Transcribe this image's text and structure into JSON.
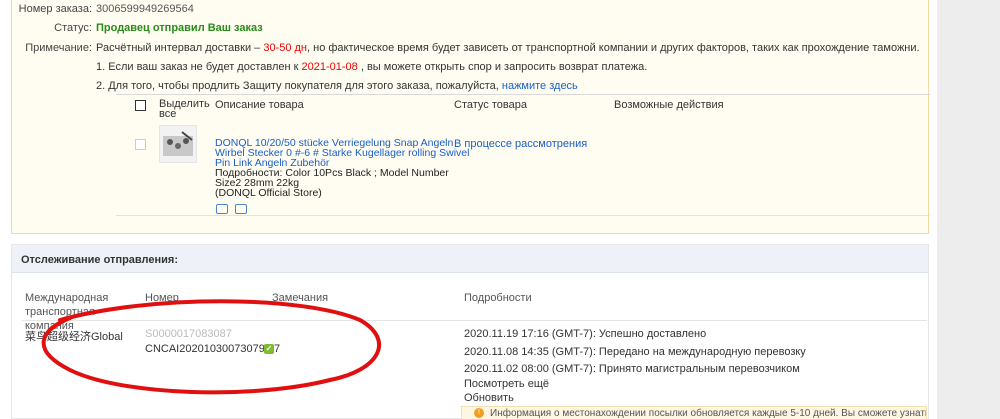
{
  "order": {
    "order_no_label": "Номер заказа:",
    "order_no": "3006599949269564",
    "status_label": "Статус:",
    "status": "Продавец отправил Ваш заказ",
    "note_label": "Примечание:",
    "note_prefix": "Расчётный интервал доставки –",
    "note_interval": "30-50 дн",
    "note_suffix": ", но фактическое время будет зависеть от транспортной компании и других факторов, таких как прохождение таможни.",
    "rule1_prefix": "1. Если ваш заказ не будет доставлен к",
    "rule1_date": "2021-01-08",
    "rule1_suffix": ", вы можете открыть спор и запросить возврат платежа.",
    "rule2_text": "2. Для того, чтобы продлить Защиту покупателя для этого заказа, пожалуйста,",
    "rule2_link": "нажмите здесь"
  },
  "items_table": {
    "col_select": "Выделить все",
    "col_description": "Описание товара",
    "col_status": "Статус товара",
    "col_actions": "Возможные действия",
    "rows": [
      {
        "title": "DONQL 10/20/50 stücke Verriegelung Snap Angeln Wirbel Stecker 0 #-6 # Starke Kugellager rolling Swivel Pin Link Angeln Zubehör",
        "details_1": "Подробности: Color 10Pcs Black ; Model Number Size2 28mm 22kg",
        "details_2": "(DONQL Official Store)",
        "status": "В процессе рассмотрения",
        "icons": [
          "truck-icon",
          "receipt-icon"
        ]
      }
    ]
  },
  "tracking": {
    "title": "Отслеживание отправления:",
    "col_carrier": "Международная транспортная компания",
    "col_number": "Номер",
    "col_remarks": "Замечания",
    "col_details": "Подробности",
    "carrier": "菜鸟超级经济Global",
    "old_number": "S0000017083087",
    "tracking_number": "CNCAI202010300730791 7",
    "events": [
      "2020.11.19 17:16 (GMT-7): Успешно доставлено",
      "2020.11.08 14:35 (GMT-7): Передано на международную перевозку",
      "2020.11.02 08:00 (GMT-7): Принято магистральным перевозчиком"
    ],
    "see_more": "Посмотреть ещё",
    "refresh": "Обновить",
    "notice": "Информация о местонахождении посылки обновляется каждые 5-10 дней. Вы сможете узнать",
    "notice_icon": "warning-icon"
  },
  "colors": {
    "status_green": "#2a8a1a",
    "accent_red": "#e00000",
    "link_blue": "#1a5ec8",
    "annotation_red": "#e01010"
  }
}
